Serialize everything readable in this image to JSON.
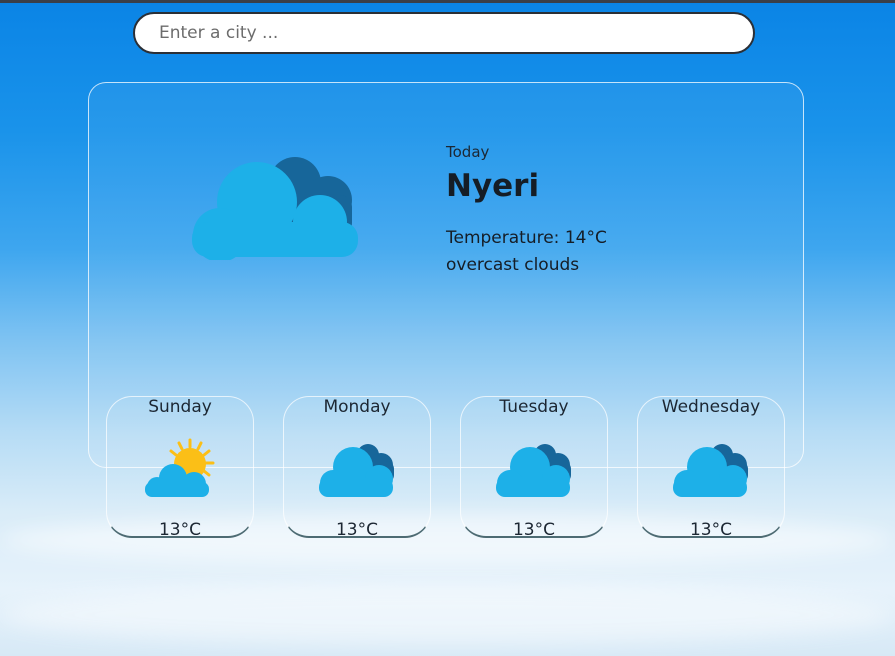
{
  "search": {
    "placeholder": "Enter a city ..."
  },
  "current": {
    "label": "Today",
    "city": "Nyeri",
    "temperature": "Temperature: 14°C",
    "description": "overcast clouds",
    "icon": "overcast-clouds-icon"
  },
  "forecast": [
    {
      "day": "Sunday",
      "temp": "13°C",
      "icon": "partly-sunny-icon"
    },
    {
      "day": "Monday",
      "temp": "13°C",
      "icon": "broken-clouds-icon"
    },
    {
      "day": "Tuesday",
      "temp": "13°C",
      "icon": "broken-clouds-icon"
    },
    {
      "day": "Wednesday",
      "temp": "13°C",
      "icon": "broken-clouds-icon"
    }
  ],
  "colors": {
    "cloud_front": "#1db0e8",
    "cloud_back": "#17669a",
    "sun": "#fbbf17"
  }
}
